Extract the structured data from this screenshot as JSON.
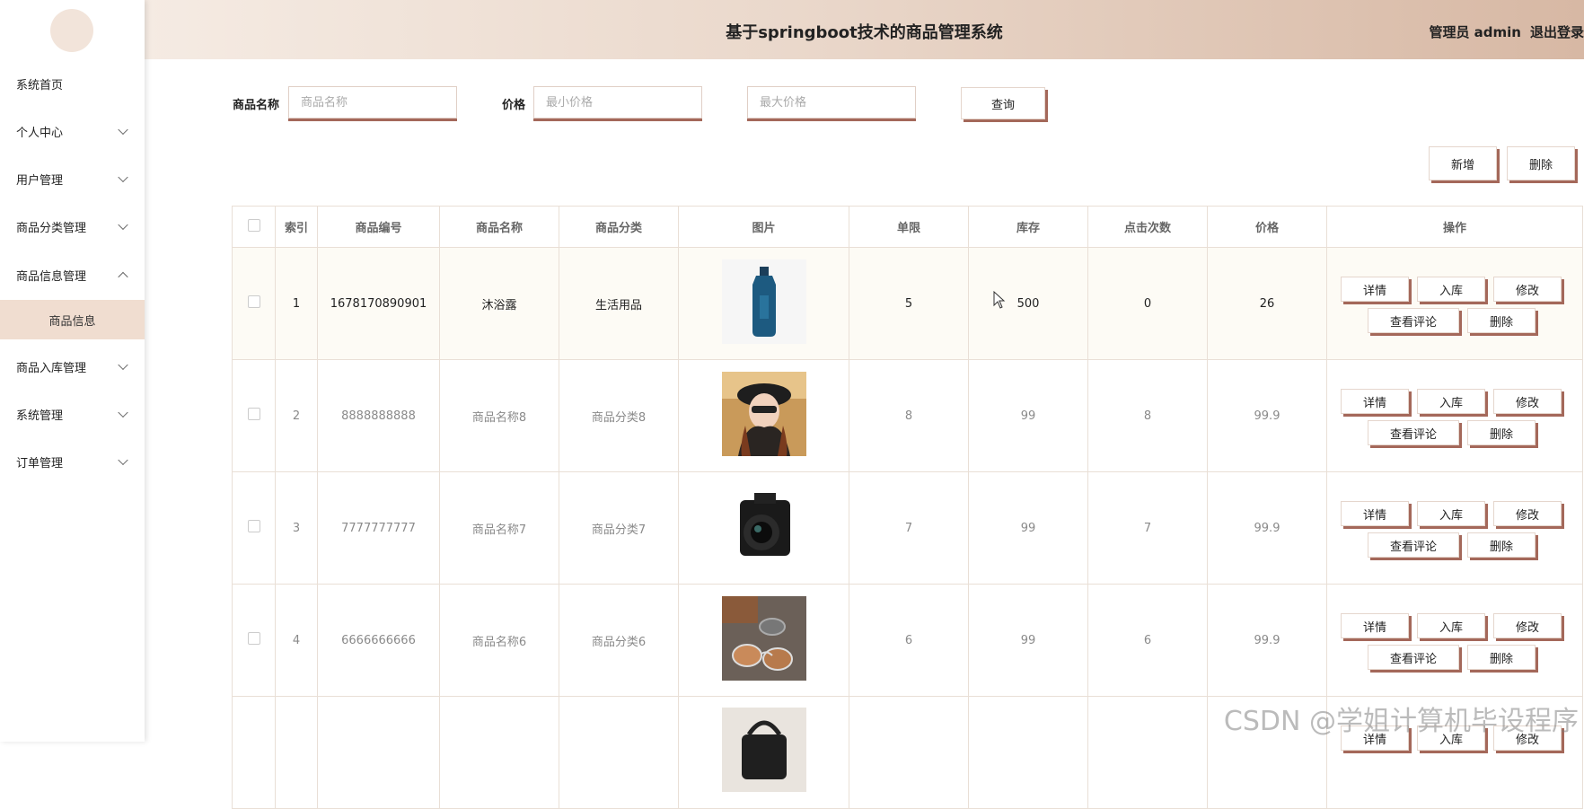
{
  "sidebar": {
    "items": [
      {
        "label": "系统首页"
      },
      {
        "label": "个人中心"
      },
      {
        "label": "用户管理"
      },
      {
        "label": "商品分类管理"
      },
      {
        "label": "商品信息管理"
      },
      {
        "label": "商品入库管理"
      },
      {
        "label": "系统管理"
      },
      {
        "label": "订单管理"
      }
    ],
    "sub_item": "商品信息"
  },
  "header": {
    "title": "基于springboot技术的商品管理系统",
    "user": "管理员 admin",
    "logout": "退出登录"
  },
  "search": {
    "name_label": "商品名称",
    "name_placeholder": "商品名称",
    "price_label": "价格",
    "min_placeholder": "最小价格",
    "max_placeholder": "最大价格",
    "query_label": "查询"
  },
  "toolbar": {
    "add_label": "新增",
    "delete_label": "删除"
  },
  "table": {
    "columns": [
      "索引",
      "商品编号",
      "商品名称",
      "商品分类",
      "图片",
      "单限",
      "库存",
      "点击次数",
      "价格",
      "操作"
    ],
    "rows": [
      {
        "index": "1",
        "code": "1678170890901",
        "name": "沐浴露",
        "category": "生活用品",
        "limit": "5",
        "stock": "500",
        "clicks": "0",
        "price": "26"
      },
      {
        "index": "2",
        "code": "8888888888",
        "name": "商品名称8",
        "category": "商品分类8",
        "limit": "8",
        "stock": "99",
        "clicks": "8",
        "price": "99.9"
      },
      {
        "index": "3",
        "code": "7777777777",
        "name": "商品名称7",
        "category": "商品分类7",
        "limit": "7",
        "stock": "99",
        "clicks": "7",
        "price": "99.9"
      },
      {
        "index": "4",
        "code": "6666666666",
        "name": "商品名称6",
        "category": "商品分类6",
        "limit": "6",
        "stock": "99",
        "clicks": "6",
        "price": "99.9"
      },
      {
        "index": "",
        "code": "",
        "name": "",
        "category": "",
        "limit": "",
        "stock": "",
        "clicks": "",
        "price": ""
      }
    ],
    "actions": {
      "detail": "详情",
      "stock_in": "入库",
      "edit": "修改",
      "comments": "查看评论",
      "delete": "删除"
    }
  },
  "watermark": "CSDN @学姐计算机毕设程序"
}
